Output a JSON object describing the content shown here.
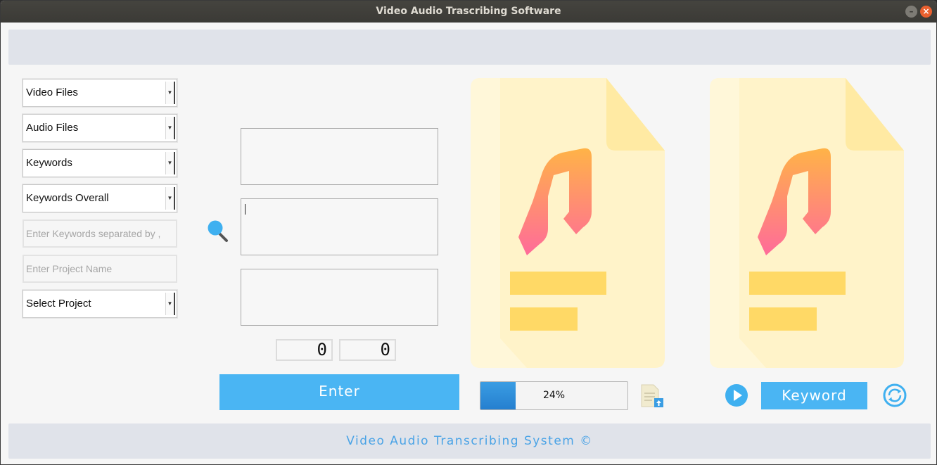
{
  "window": {
    "title": "Video Audio Trascribing Software",
    "minimize_glyph": "–",
    "close_glyph": "×"
  },
  "left_panel": {
    "dropdowns": [
      {
        "selected": "Video Files"
      },
      {
        "selected": "Audio Files"
      },
      {
        "selected": "Keywords"
      },
      {
        "selected": "Keywords Overall"
      }
    ],
    "keywords_input": {
      "value": "",
      "placeholder": "Enter Keywords separated by ,"
    },
    "project_input": {
      "value": "",
      "placeholder": "Enter Project Name"
    },
    "project_dropdown": {
      "selected": "Select Project"
    },
    "dropdown_arrow_glyph": "▼"
  },
  "center_panel": {
    "search_icon": "search-icon",
    "text_areas": [
      {
        "value": ""
      },
      {
        "value": ""
      },
      {
        "value": ""
      }
    ],
    "counters": [
      "0",
      "0"
    ],
    "enter_button": "Enter"
  },
  "right_panel": {
    "file_icons": [
      "audio-file-icon",
      "audio-file-icon"
    ],
    "progress": {
      "value": 0.24,
      "label": "24%"
    },
    "upload_icon": "document-upload-icon",
    "play_icon": "play-icon",
    "keyword_button": "Keyword",
    "refresh_icon": "refresh-icon"
  },
  "footer": {
    "text": "Video Audio Transcribing System ©"
  },
  "colors": {
    "accent": "#4ab5f3",
    "progress_fill": "#2c8ad8",
    "file_bg": "#fff3c9",
    "file_bar": "#ffd966",
    "note_gradient_top": "#ffb347",
    "note_gradient_bottom": "#ff6b9a",
    "bar_background": "#e0e3ea"
  }
}
